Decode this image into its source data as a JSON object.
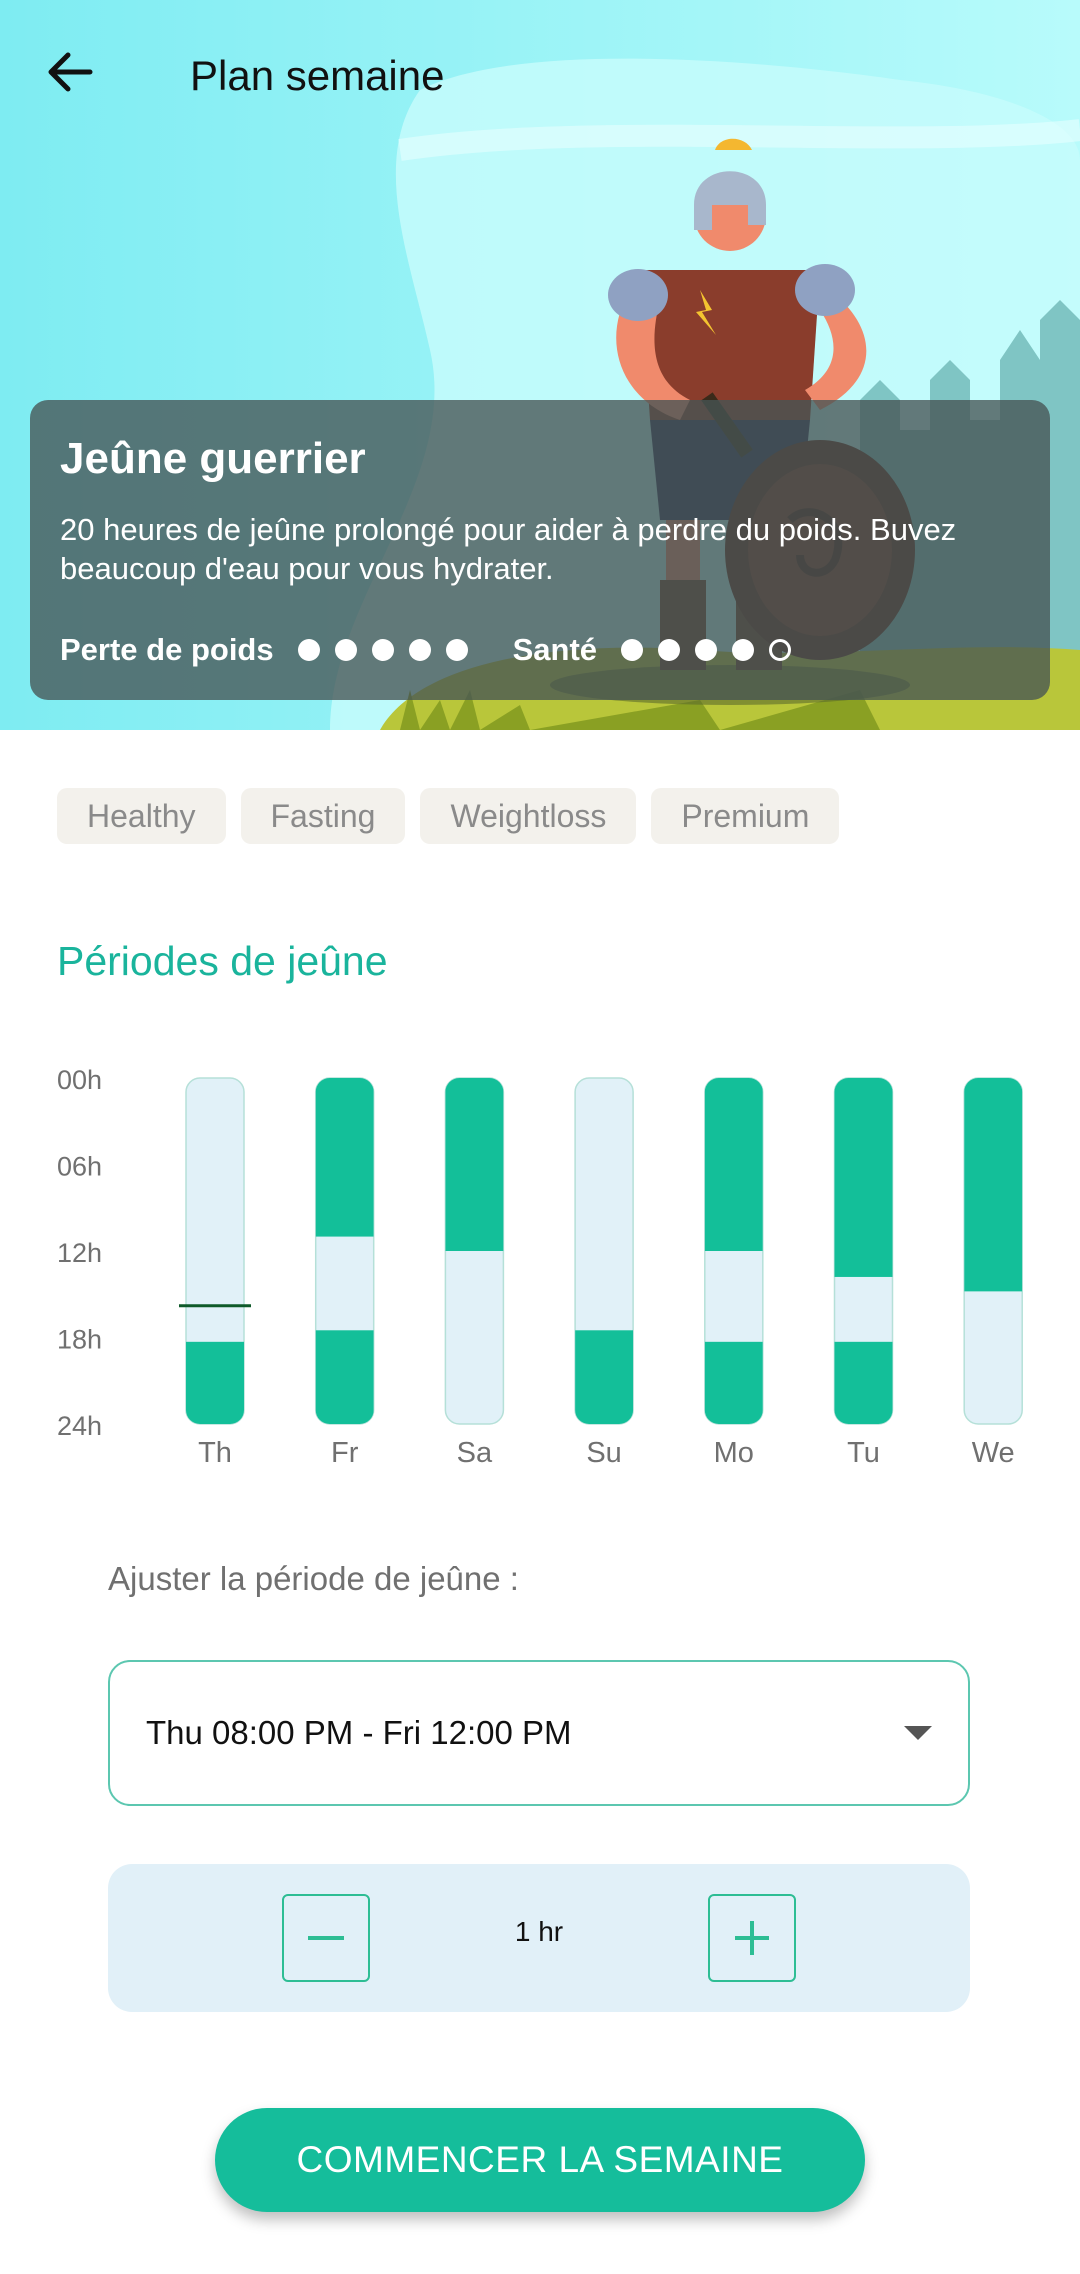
{
  "header": {
    "title": "Plan semaine"
  },
  "plan": {
    "name": "Jeûne guerrier",
    "description": "20 heures de jeûne prolongé pour aider à perdre du poids. Buvez beaucoup d'eau pour vous hydrater.",
    "ratings": [
      {
        "label": "Perte de poids",
        "value": 5,
        "max": 5
      },
      {
        "label": "Santé",
        "value": 4,
        "max": 5
      }
    ]
  },
  "tags": [
    "Healthy",
    "Fasting",
    "Weightloss",
    "Premium"
  ],
  "section_title": "Périodes de jeûne",
  "chart_data": {
    "type": "bar",
    "y_ticks": [
      "00h",
      "06h",
      "12h",
      "18h",
      "24h"
    ],
    "y_range_hours": [
      0,
      24
    ],
    "categories": [
      "Th",
      "Fr",
      "Sa",
      "Su",
      "Mo",
      "Tu",
      "We"
    ],
    "fasting_segments_hours": [
      [
        [
          18.3,
          24
        ]
      ],
      [
        [
          0,
          11
        ],
        [
          17.5,
          24
        ]
      ],
      [
        [
          0,
          12
        ]
      ],
      [
        [
          17.5,
          24
        ]
      ],
      [
        [
          0,
          12
        ],
        [
          18.3,
          24
        ]
      ],
      [
        [
          0,
          13.8
        ],
        [
          18.3,
          24
        ]
      ],
      [
        [
          0,
          14.8
        ]
      ]
    ],
    "current_time_marker": {
      "day": "Th",
      "hour": 15.8
    },
    "colors": {
      "fasting": "#13bf99",
      "eating": "#e1f1f8",
      "eating_border": "#b5e0d8",
      "marker": "#0f5a2a"
    }
  },
  "adjust": {
    "label": "Ajuster la période de jeûne :",
    "selected_period": "Thu 08:00 PM - Fri 12:00 PM",
    "step_value": "1 hr"
  },
  "cta": {
    "label": "COMMENCER LA SEMAINE"
  },
  "colors": {
    "accent": "#15bd9b",
    "hero_bg": "#b6f6f6",
    "title_teal": "#1ab49c"
  }
}
